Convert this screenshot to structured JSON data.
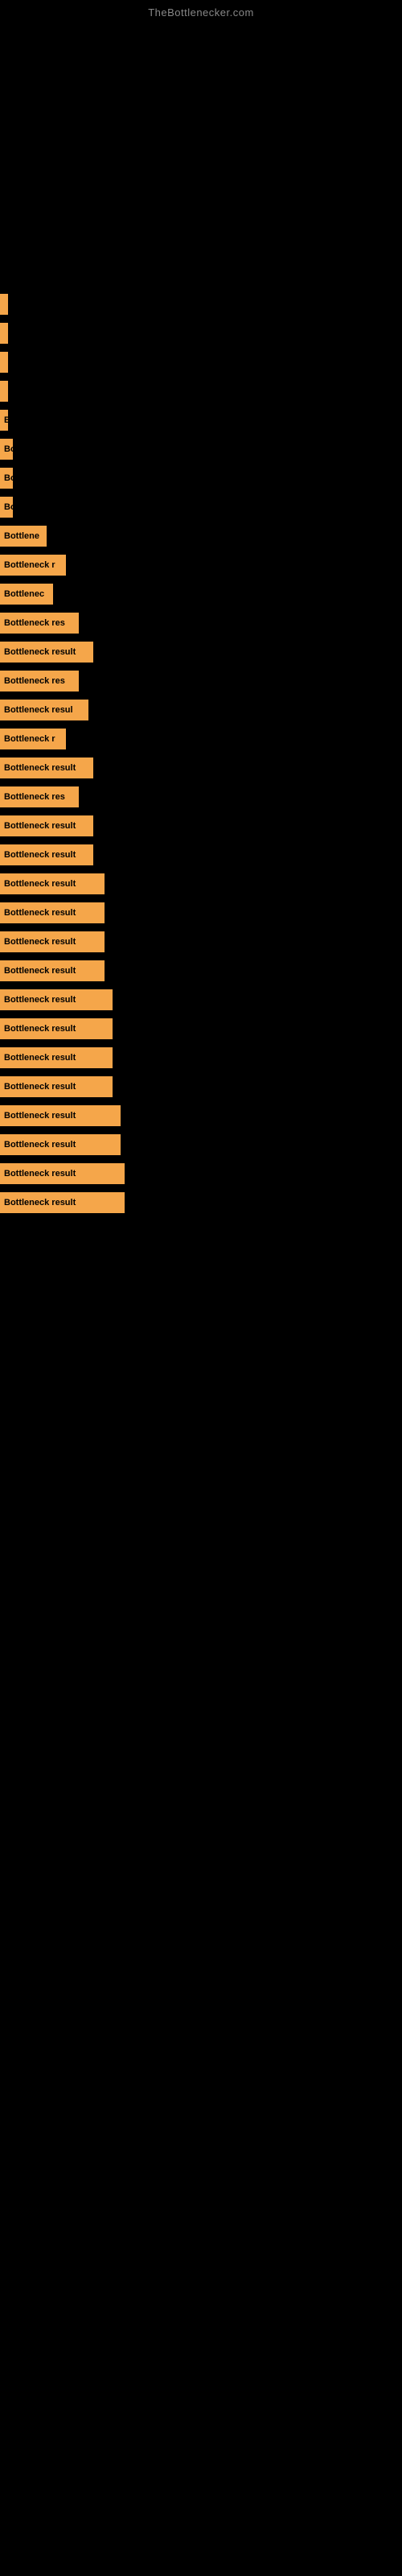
{
  "site": {
    "title": "TheBottlenecker.com"
  },
  "bars": [
    {
      "label": "",
      "width": 2
    },
    {
      "label": "",
      "width": 2
    },
    {
      "label": "",
      "width": 2
    },
    {
      "label": "",
      "width": 2
    },
    {
      "label": "B",
      "width": 10
    },
    {
      "label": "Bo",
      "width": 16
    },
    {
      "label": "Bo",
      "width": 16
    },
    {
      "label": "Bo",
      "width": 16
    },
    {
      "label": "Bottlene",
      "width": 58
    },
    {
      "label": "Bottleneck r",
      "width": 82
    },
    {
      "label": "Bottlenec",
      "width": 66
    },
    {
      "label": "Bottleneck res",
      "width": 98
    },
    {
      "label": "Bottleneck result",
      "width": 116
    },
    {
      "label": "Bottleneck res",
      "width": 98
    },
    {
      "label": "Bottleneck resul",
      "width": 110
    },
    {
      "label": "Bottleneck r",
      "width": 82
    },
    {
      "label": "Bottleneck result",
      "width": 116
    },
    {
      "label": "Bottleneck res",
      "width": 98
    },
    {
      "label": "Bottleneck result",
      "width": 116
    },
    {
      "label": "Bottleneck result",
      "width": 116
    },
    {
      "label": "Bottleneck result",
      "width": 130
    },
    {
      "label": "Bottleneck result",
      "width": 130
    },
    {
      "label": "Bottleneck result",
      "width": 130
    },
    {
      "label": "Bottleneck result",
      "width": 130
    },
    {
      "label": "Bottleneck result",
      "width": 140
    },
    {
      "label": "Bottleneck result",
      "width": 140
    },
    {
      "label": "Bottleneck result",
      "width": 140
    },
    {
      "label": "Bottleneck result",
      "width": 140
    },
    {
      "label": "Bottleneck result",
      "width": 150
    },
    {
      "label": "Bottleneck result",
      "width": 150
    },
    {
      "label": "Bottleneck result",
      "width": 155
    },
    {
      "label": "Bottleneck result",
      "width": 155
    }
  ]
}
